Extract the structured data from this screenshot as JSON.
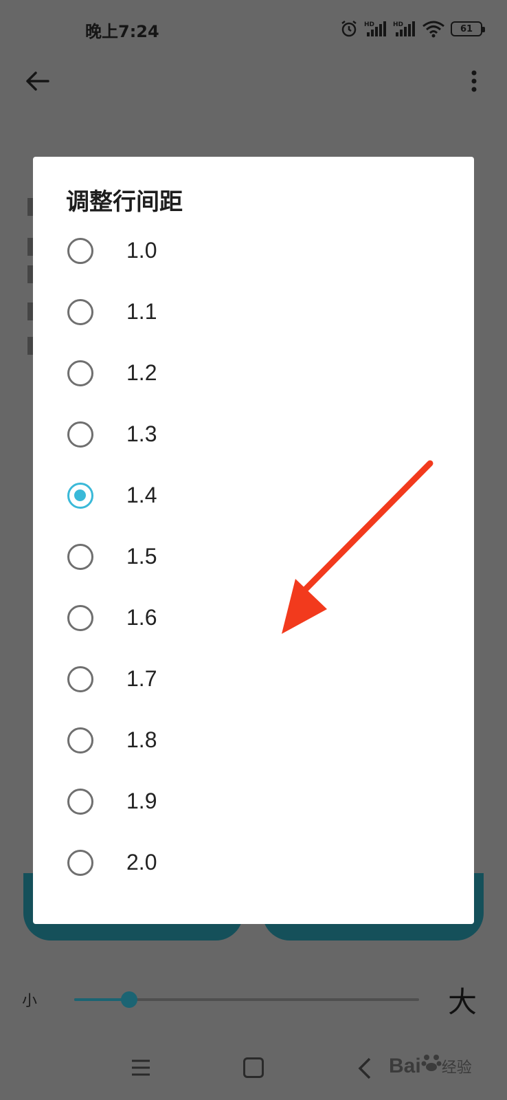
{
  "status_bar": {
    "time": "晚上7:24",
    "battery": "61"
  },
  "dialog": {
    "title": "调整行间距",
    "options": [
      {
        "label": "1.0",
        "checked": false
      },
      {
        "label": "1.1",
        "checked": false
      },
      {
        "label": "1.2",
        "checked": false
      },
      {
        "label": "1.3",
        "checked": false
      },
      {
        "label": "1.4",
        "checked": true
      },
      {
        "label": "1.5",
        "checked": false
      },
      {
        "label": "1.6",
        "checked": false
      },
      {
        "label": "1.7",
        "checked": false
      },
      {
        "label": "1.8",
        "checked": false
      },
      {
        "label": "1.9",
        "checked": false
      },
      {
        "label": "2.0",
        "checked": false
      }
    ]
  },
  "font_size_slider": {
    "small_label": "小",
    "large_label": "大",
    "value_fraction": 0.16
  },
  "watermark": {
    "brand": "Bai",
    "suffix": "经验"
  },
  "colors": {
    "accent": "#3ab9d8",
    "annotation_arrow": "#f23a1d",
    "scrim": "#676767"
  }
}
